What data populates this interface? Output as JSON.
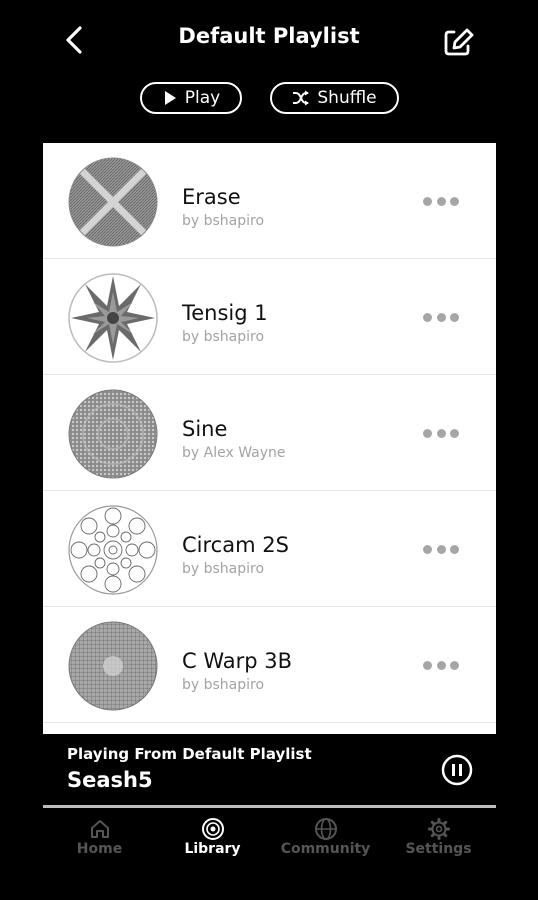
{
  "header": {
    "title": "Default Playlist",
    "back_icon": "chevron-left-icon",
    "edit_icon": "edit-icon"
  },
  "actions": {
    "play_label": "Play",
    "shuffle_label": "Shuffle"
  },
  "tracks": [
    {
      "name": "Erase",
      "author": "by bshapiro",
      "thumb": "x-pattern"
    },
    {
      "name": "Tensig 1",
      "author": "by bshapiro",
      "thumb": "star-pattern"
    },
    {
      "name": "Sine",
      "author": "by Alex Wayne",
      "thumb": "dense-pattern"
    },
    {
      "name": "Circam 2S",
      "author": "by bshapiro",
      "thumb": "circles-pattern"
    },
    {
      "name": "C Warp 3B",
      "author": "by bshapiro",
      "thumb": "grid-pattern"
    }
  ],
  "now_playing": {
    "label": "Playing From Default Playlist",
    "track": "Seash5"
  },
  "tabs": [
    {
      "label": "Home",
      "icon": "home-icon",
      "active": false
    },
    {
      "label": "Library",
      "icon": "library-icon",
      "active": true
    },
    {
      "label": "Community",
      "icon": "globe-icon",
      "active": false
    },
    {
      "label": "Settings",
      "icon": "gear-icon",
      "active": false
    }
  ],
  "colors": {
    "background": "#000000",
    "list_bg": "#ffffff",
    "inactive_tab": "#555555",
    "more_dots": "#a6a6a6"
  }
}
